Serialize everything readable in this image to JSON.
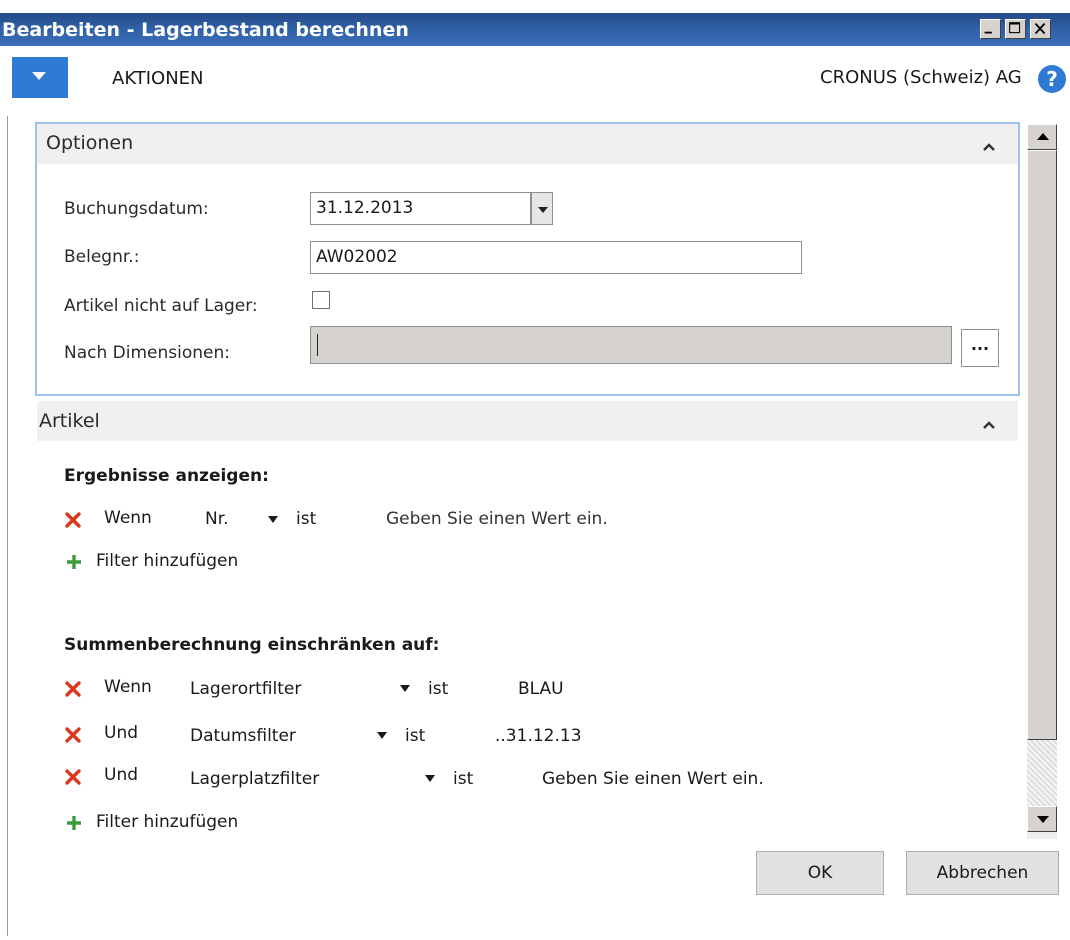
{
  "window": {
    "title": "Bearbeiten - Lagerbestand berechnen",
    "controls": [
      "minimize-icon",
      "maximize-icon",
      "close-icon"
    ]
  },
  "actionbar": {
    "actions_label": "AKTIONEN",
    "company": "CRONUS (Schweiz) AG",
    "help_glyph": "?"
  },
  "options": {
    "title": "Optionen",
    "posting_date_label": "Buchungsdatum:",
    "posting_date_value": "31.12.2013",
    "document_no_label": "Belegnr.:",
    "document_no_value": "AW02002",
    "items_not_in_stock_label": "Artikel nicht auf Lager:",
    "items_not_in_stock_checked": false,
    "by_dimensions_label": "Nach Dimensionen:",
    "by_dimensions_value": "",
    "assist_button": "..."
  },
  "artikel": {
    "title": "Artikel",
    "results_heading": "Ergebnisse anzeigen:",
    "results_filters": [
      {
        "conj": "Wenn",
        "field": "Nr.",
        "op": "ist",
        "value": "Geben Sie einen Wert ein."
      }
    ],
    "add_filter_label": "Filter hinzufügen",
    "sums_heading": "Summenberechnung einschränken auf:",
    "sums_filters": [
      {
        "conj": "Wenn",
        "field": "Lagerortfilter",
        "op": "ist",
        "value": "BLAU"
      },
      {
        "conj": "Und",
        "field": "Datumsfilter",
        "op": "ist",
        "value": "..31.12.13"
      },
      {
        "conj": "Und",
        "field": "Lagerplatzfilter",
        "op": "ist",
        "value": "Geben Sie einen Wert ein."
      }
    ],
    "add_filter_label_2": "Filter hinzufügen"
  },
  "buttons": {
    "ok": "OK",
    "cancel": "Abbrechen"
  },
  "colors": {
    "titlebar": "#2f5fa6",
    "accent": "#2f7bd3",
    "remove_icon": "#d9381e",
    "add_icon": "#3c9a3c",
    "section_border": "#9fc1ec"
  }
}
